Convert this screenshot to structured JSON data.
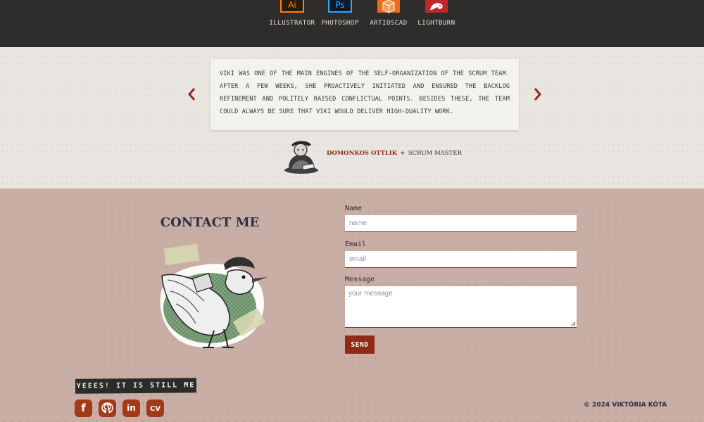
{
  "skills": [
    {
      "label": "ILLUSTRATOR",
      "icon": "adobe-illustrator-icon",
      "glyph": "Ai"
    },
    {
      "label": "PHOTOSHOP",
      "icon": "adobe-photoshop-icon",
      "glyph": "Ps"
    },
    {
      "label": "ARTIOSCAD",
      "icon": "artioscad-icon"
    },
    {
      "label": "LIGHTBURN",
      "icon": "lightburn-icon"
    }
  ],
  "testimonial": {
    "quote": "VIKI WAS ONE OF THE MAIN ENGINES OF THE SELF-ORGANIZATION OF THE SCRUM TEAM. AFTER A FEW WEEKS, SHE PROACTIVELY INITIATED AND ENSURED THE BACKLOG REFINEMENT AND POLITELY RAISED CONFLICTUAL POINTS. BESIDES THESE, THE TEAM COULD ALWAYS BE SURE THAT VIKI WOULD DELIVER HIGH-QUALITY WORK.",
    "author_name": "DOMONKOS OTTLIK",
    "separator": "★",
    "author_role": "SCRUM MASTER",
    "prev_icon": "chevron-left-icon",
    "next_icon": "chevron-right-icon"
  },
  "contact": {
    "title": "CONTACT ME",
    "name_label": "Name",
    "name_placeholder": "name",
    "email_label": "Email",
    "email_placeholder": "email",
    "message_label": "Message",
    "message_placeholder": "your message",
    "send_label": "SEND"
  },
  "footer": {
    "tagline": "YEEES! IT IS STILL ME",
    "social": [
      {
        "name": "facebook",
        "glyph": "f"
      },
      {
        "name": "github",
        "glyph": "⚉"
      },
      {
        "name": "linkedin",
        "glyph": "in"
      },
      {
        "name": "cv",
        "glyph": "CV"
      }
    ],
    "copyright": "© 2024 VIKTÓRIA KÓTA"
  },
  "colors": {
    "dark_band": "#2e2d2c",
    "accent": "#8f2a16",
    "social_bg": "#a33a17",
    "navy_text": "#2d3147",
    "illustrator_orange": "#ff7f18",
    "photoshop_blue": "#31a8ff"
  }
}
